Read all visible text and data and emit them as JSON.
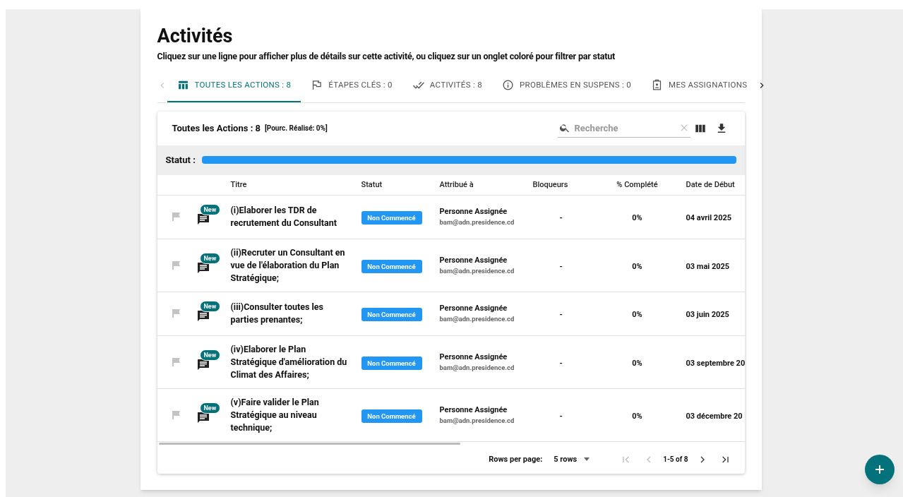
{
  "page": {
    "title": "Activités",
    "subtitle": "Cliquez sur une ligne pour afficher plus de détails sur cette activité, ou cliquez sur un onglet coloré pour filtrer par statut"
  },
  "tab_scroll": {
    "left_disabled": true,
    "right_disabled": false
  },
  "tabs": [
    {
      "label": "TOUTES LES ACTIONS : 8",
      "selected": true
    },
    {
      "label": "ÉTAPES CLÉS : 0",
      "selected": false
    },
    {
      "label": "ACTIVITÉS : 8",
      "selected": false
    },
    {
      "label": "PROBLÈMES EN SUSPENS : 0",
      "selected": false
    },
    {
      "label": "MES ASSIGNATIONS",
      "selected": false
    }
  ],
  "table": {
    "title": "Toutes les Actions : 8",
    "summary": "[Pourc. Réalisé: 0%]",
    "search": {
      "placeholder": "Recherche"
    },
    "status_bar": {
      "label": "Statut :"
    },
    "columns": [
      "Titre",
      "Statut",
      "Attribué à",
      "Bloqueurs",
      "% Complété",
      "Date de Début"
    ],
    "rows": [
      {
        "badge": "New",
        "title": "(i)Elaborer les TDR de recrutement du Consultant",
        "status": "Non Commencé",
        "assignee": "Personne Assignée",
        "email": "bam@adn.presidence.cd",
        "blockers": "-",
        "complete": "0%",
        "start": "04 avril 2025"
      },
      {
        "badge": "New",
        "title": "(ii)Recruter un Consultant en vue de l'élaboration du Plan Stratégique;",
        "status": "Non Commencé",
        "assignee": "Personne Assignée",
        "email": "bam@adn.presidence.cd",
        "blockers": "-",
        "complete": "0%",
        "start": "03 mai 2025"
      },
      {
        "badge": "New",
        "title": "(iii)Consulter toutes les parties prenantes;",
        "status": "Non Commencé",
        "assignee": "Personne Assignée",
        "email": "bam@adn.presidence.cd",
        "blockers": "-",
        "complete": "0%",
        "start": "03 juin 2025"
      },
      {
        "badge": "New",
        "title": "(iv)Elaborer le Plan Stratégique d'amélioration du Climat des Affaires;",
        "status": "Non Commencé",
        "assignee": "Personne Assignée",
        "email": "bam@adn.presidence.cd",
        "blockers": "-",
        "complete": "0%",
        "start": "03 septembre 20"
      },
      {
        "badge": "New",
        "title": "(v)Faire valider le Plan Stratégique au niveau technique;",
        "status": "Non Commencé",
        "assignee": "Personne Assignée",
        "email": "bam@adn.presidence.cd",
        "blockers": "-",
        "complete": "0%",
        "start": "03 décembre 20"
      }
    ],
    "pagination": {
      "rows_label": "Rows per page:",
      "rows_value": "5 rows",
      "range": "1-5 of 8",
      "nav": [
        {
          "kind": "first",
          "disabled": true
        },
        {
          "kind": "prev",
          "disabled": true
        },
        {
          "kind": "next",
          "disabled": false
        },
        {
          "kind": "last",
          "disabled": false
        }
      ]
    }
  }
}
